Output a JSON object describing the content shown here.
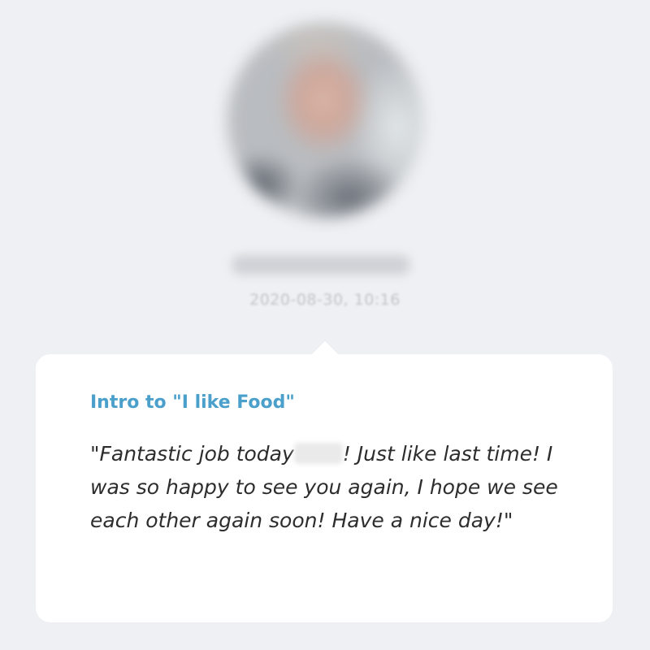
{
  "header": {
    "timestamp": "2020-08-30, 10:16"
  },
  "card": {
    "title": "Intro to \"I like Food\"",
    "message_part1": "\"Fantastic job today",
    "message_part2": "! Just like last time! I was so happy to see you again, I hope we see each other again soon! Have a nice day!\""
  },
  "colors": {
    "background": "#eef0f3",
    "card_background": "#ffffff",
    "title_accent": "#4aa0cb",
    "message_text": "#2d2d2d"
  }
}
